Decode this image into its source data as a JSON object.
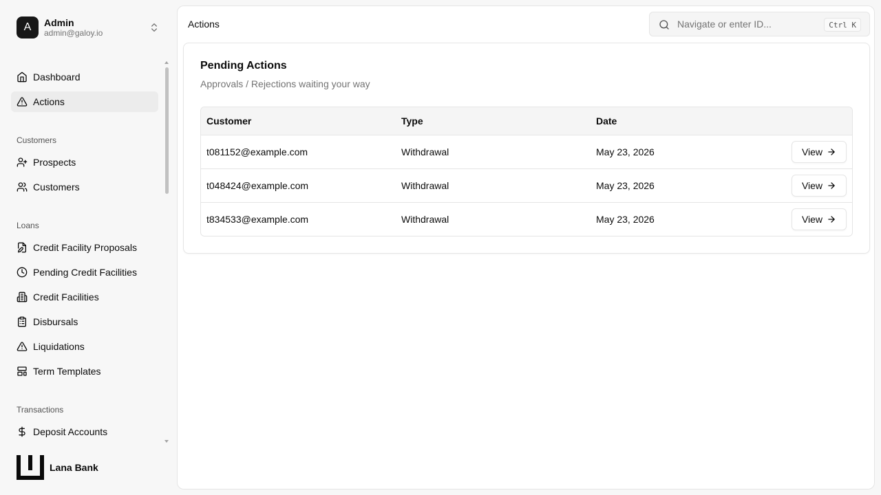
{
  "user": {
    "initial": "A",
    "name": "Admin",
    "email": "admin@galoy.io"
  },
  "nav": {
    "top": [
      {
        "label": "Dashboard",
        "icon": "home-icon"
      },
      {
        "label": "Actions",
        "icon": "alert-triangle-icon",
        "active": true
      }
    ],
    "customers_group": "Customers",
    "customers": [
      {
        "label": "Prospects",
        "icon": "user-plus-icon"
      },
      {
        "label": "Customers",
        "icon": "users-icon"
      }
    ],
    "loans_group": "Loans",
    "loans": [
      {
        "label": "Credit Facility Proposals",
        "icon": "file-edit-icon"
      },
      {
        "label": "Pending Credit Facilities",
        "icon": "clock-icon"
      },
      {
        "label": "Credit Facilities",
        "icon": "building-icon"
      },
      {
        "label": "Disbursals",
        "icon": "clipboard-icon"
      },
      {
        "label": "Liquidations",
        "icon": "alert-triangle-icon"
      },
      {
        "label": "Term Templates",
        "icon": "layout-template-icon"
      }
    ],
    "transactions_group": "Transactions",
    "transactions": [
      {
        "label": "Deposit Accounts",
        "icon": "dollar-sign-icon"
      }
    ]
  },
  "brand": {
    "name": "Lana Bank"
  },
  "header": {
    "breadcrumb": "Actions",
    "search_placeholder": "Navigate or enter ID...",
    "shortcut": "Ctrl K"
  },
  "card": {
    "title": "Pending Actions",
    "description": "Approvals / Rejections waiting your way",
    "columns": [
      "Customer",
      "Type",
      "Date"
    ],
    "rows": [
      {
        "customer": "t081152@example.com",
        "type": "Withdrawal",
        "date": "May 23, 2026",
        "action": "View"
      },
      {
        "customer": "t048424@example.com",
        "type": "Withdrawal",
        "date": "May 23, 2026",
        "action": "View"
      },
      {
        "customer": "t834533@example.com",
        "type": "Withdrawal",
        "date": "May 23, 2026",
        "action": "View"
      }
    ]
  },
  "colors": {
    "accent": "#171717",
    "muted_text": "#737373",
    "border": "#e5e5e5"
  }
}
